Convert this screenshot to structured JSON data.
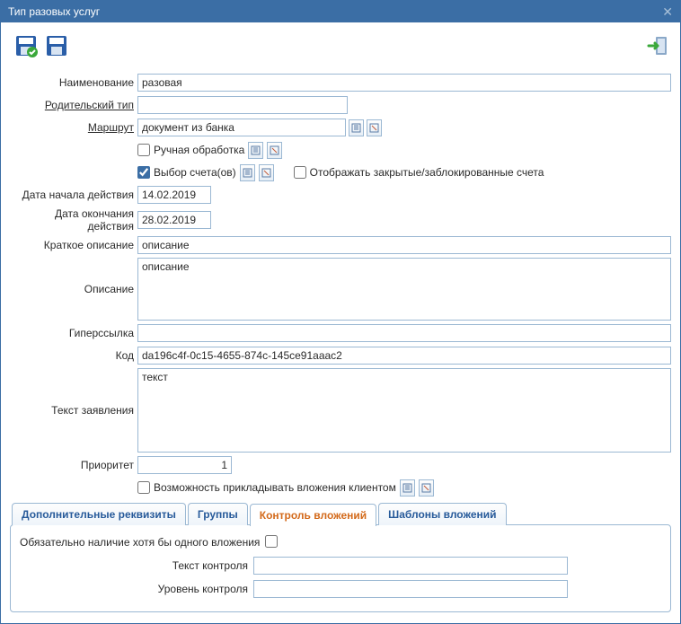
{
  "window": {
    "title": "Тип разовых услуг"
  },
  "toolbar": {
    "save_ok": "Сохранить и закрыть",
    "save": "Сохранить",
    "exit": "Выход"
  },
  "form": {
    "name_label": "Наименование",
    "name_value": "разовая",
    "parent_label": "Родительский тип",
    "parent_value": "",
    "route_label": "Маршрут",
    "route_value": "документ из банка",
    "manual_label": "Ручная обработка",
    "manual_checked": false,
    "account_sel_label": "Выбор счета(ов)",
    "account_sel_checked": true,
    "show_closed_label": "Отображать закрытые/заблокированные счета",
    "show_closed_checked": false,
    "start_date_label": "Дата начала действия",
    "start_date_value": "14.02.2019",
    "end_date_label": "Дата окончания действия",
    "end_date_value": "28.02.2019",
    "short_desc_label": "Краткое описание",
    "short_desc_value": "описание",
    "desc_label": "Описание",
    "desc_value": "описание",
    "hyper_label": "Гиперссылка",
    "hyper_value": "",
    "code_label": "Код",
    "code_value": "da196c4f-0c15-4655-874c-145ce91aaac2",
    "app_text_label": "Текст заявления",
    "app_text_value": "текст",
    "priority_label": "Приоритет",
    "priority_value": "1",
    "attach_label": "Возможность прикладывать вложения клиентом",
    "attach_checked": false
  },
  "tabs": {
    "items": [
      {
        "label": "Дополнительные реквизиты"
      },
      {
        "label": "Группы"
      },
      {
        "label": "Контроль вложений"
      },
      {
        "label": "Шаблоны вложений"
      }
    ],
    "active_index": 2
  },
  "attachment_control": {
    "required_label": "Обязательно наличие хотя бы одного вложения",
    "required_checked": false,
    "control_text_label": "Текст контроля",
    "control_text_value": "",
    "control_level_label": "Уровень контроля",
    "control_level_value": ""
  }
}
